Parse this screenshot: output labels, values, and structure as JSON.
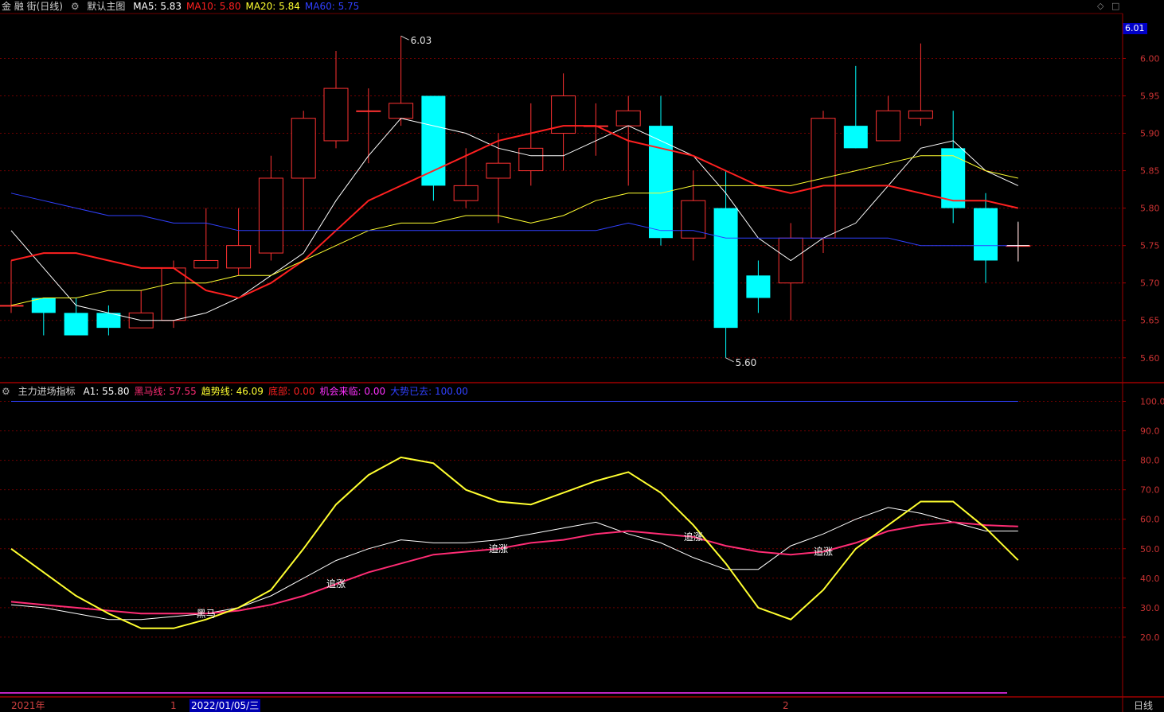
{
  "header": {
    "stock_name": "金 融 街(日线)",
    "main_chart_label": "默认主图",
    "ma": [
      {
        "label": "MA5: 5.83",
        "color": "#ffffff"
      },
      {
        "label": "MA10: 5.80",
        "color": "#ff2020"
      },
      {
        "label": "MA20: 5.84",
        "color": "#ffff30"
      },
      {
        "label": "MA60: 5.75",
        "color": "#3040ff"
      }
    ]
  },
  "indicator": {
    "name": "主力进场指标",
    "values": [
      {
        "label": "A1: 55.80",
        "color": "#ffffff"
      },
      {
        "label": "黑马线: 57.55",
        "color": "#ff2c74"
      },
      {
        "label": "趋势线: 46.09",
        "color": "#ffff30"
      },
      {
        "label": "底部: 0.00",
        "color": "#ff2020"
      },
      {
        "label": "机会来临: 0.00",
        "color": "#ff30ff"
      },
      {
        "label": "大势已去: 100.00",
        "color": "#3040ff"
      }
    ]
  },
  "axis_bottom": {
    "year_label": "2021年",
    "month_1": "1",
    "month_2": "2",
    "cursor_date": "2022/01/05/三",
    "period_label": "日线"
  },
  "price_tag": "6.01",
  "colors": {
    "up": "#ff3232",
    "down": "#00ffff",
    "grid": "#6e0000",
    "bg": "#000000"
  },
  "chart_data": [
    {
      "type": "candlestick",
      "title": "金 融 街(日线)",
      "ylim": [
        5.57,
        6.06
      ],
      "y_ticks": [
        5.6,
        5.65,
        5.7,
        5.75,
        5.8,
        5.85,
        5.9,
        5.95,
        6.0
      ],
      "annotations": [
        {
          "text": "6.03",
          "value": 6.03,
          "at_index": 12
        },
        {
          "text": "5.60",
          "value": 5.6,
          "at_index": 22
        }
      ],
      "candles": [
        {
          "o": 5.67,
          "h": 5.73,
          "l": 5.66,
          "c": 5.67
        },
        {
          "o": 5.68,
          "h": 5.68,
          "l": 5.63,
          "c": 5.66
        },
        {
          "o": 5.66,
          "h": 5.68,
          "l": 5.63,
          "c": 5.63
        },
        {
          "o": 5.66,
          "h": 5.67,
          "l": 5.63,
          "c": 5.64
        },
        {
          "o": 5.64,
          "h": 5.69,
          "l": 5.64,
          "c": 5.66
        },
        {
          "o": 5.65,
          "h": 5.73,
          "l": 5.64,
          "c": 5.72
        },
        {
          "o": 5.72,
          "h": 5.8,
          "l": 5.72,
          "c": 5.73
        },
        {
          "o": 5.72,
          "h": 5.8,
          "l": 5.71,
          "c": 5.75
        },
        {
          "o": 5.74,
          "h": 5.87,
          "l": 5.73,
          "c": 5.84
        },
        {
          "o": 5.84,
          "h": 5.93,
          "l": 5.77,
          "c": 5.92
        },
        {
          "o": 5.89,
          "h": 6.01,
          "l": 5.88,
          "c": 5.96
        },
        {
          "o": 5.93,
          "h": 5.96,
          "l": 5.86,
          "c": 5.93
        },
        {
          "o": 5.92,
          "h": 6.03,
          "l": 5.91,
          "c": 5.94
        },
        {
          "o": 5.95,
          "h": 5.95,
          "l": 5.81,
          "c": 5.83
        },
        {
          "o": 5.81,
          "h": 5.88,
          "l": 5.8,
          "c": 5.83
        },
        {
          "o": 5.84,
          "h": 5.9,
          "l": 5.78,
          "c": 5.86
        },
        {
          "o": 5.85,
          "h": 5.94,
          "l": 5.83,
          "c": 5.88
        },
        {
          "o": 5.9,
          "h": 5.98,
          "l": 5.85,
          "c": 5.95
        },
        {
          "o": 5.91,
          "h": 5.94,
          "l": 5.87,
          "c": 5.91
        },
        {
          "o": 5.91,
          "h": 5.95,
          "l": 5.83,
          "c": 5.93
        },
        {
          "o": 5.91,
          "h": 5.95,
          "l": 5.75,
          "c": 5.76
        },
        {
          "o": 5.76,
          "h": 5.85,
          "l": 5.73,
          "c": 5.81
        },
        {
          "o": 5.8,
          "h": 5.85,
          "l": 5.6,
          "c": 5.64
        },
        {
          "o": 5.71,
          "h": 5.73,
          "l": 5.66,
          "c": 5.68
        },
        {
          "o": 5.7,
          "h": 5.78,
          "l": 5.65,
          "c": 5.76
        },
        {
          "o": 5.76,
          "h": 5.93,
          "l": 5.74,
          "c": 5.92
        },
        {
          "o": 5.91,
          "h": 5.99,
          "l": 5.88,
          "c": 5.88
        },
        {
          "o": 5.89,
          "h": 5.95,
          "l": 5.89,
          "c": 5.93
        },
        {
          "o": 5.92,
          "h": 6.02,
          "l": 5.91,
          "c": 5.93
        },
        {
          "o": 5.88,
          "h": 5.93,
          "l": 5.78,
          "c": 5.8
        },
        {
          "o": 5.8,
          "h": 5.82,
          "l": 5.7,
          "c": 5.73
        },
        {
          "o": 5.75,
          "h": 5.78,
          "l": 5.73,
          "c": 5.75
        }
      ],
      "series": [
        {
          "name": "MA5",
          "color": "#ffffff",
          "values": [
            5.77,
            5.72,
            5.67,
            5.66,
            5.65,
            5.65,
            5.66,
            5.68,
            5.71,
            5.74,
            5.81,
            5.87,
            5.92,
            5.91,
            5.9,
            5.88,
            5.87,
            5.87,
            5.89,
            5.91,
            5.89,
            5.87,
            5.82,
            5.76,
            5.73,
            5.76,
            5.78,
            5.83,
            5.88,
            5.89,
            5.85,
            5.83
          ]
        },
        {
          "name": "MA10",
          "color": "#ff2020",
          "values": [
            5.73,
            5.74,
            5.74,
            5.73,
            5.72,
            5.72,
            5.69,
            5.68,
            5.7,
            5.73,
            5.77,
            5.81,
            5.83,
            5.85,
            5.87,
            5.89,
            5.9,
            5.91,
            5.91,
            5.89,
            5.88,
            5.87,
            5.85,
            5.83,
            5.82,
            5.83,
            5.83,
            5.83,
            5.82,
            5.81,
            5.81,
            5.8
          ]
        },
        {
          "name": "MA20",
          "color": "#ffff30",
          "values": [
            5.67,
            5.68,
            5.68,
            5.69,
            5.69,
            5.7,
            5.7,
            5.71,
            5.71,
            5.73,
            5.75,
            5.77,
            5.78,
            5.78,
            5.79,
            5.79,
            5.78,
            5.79,
            5.81,
            5.82,
            5.82,
            5.83,
            5.83,
            5.83,
            5.83,
            5.84,
            5.85,
            5.86,
            5.87,
            5.87,
            5.85,
            5.84
          ]
        },
        {
          "name": "MA60",
          "color": "#3040ff",
          "values": [
            5.82,
            5.81,
            5.8,
            5.79,
            5.79,
            5.78,
            5.78,
            5.77,
            5.77,
            5.77,
            5.77,
            5.77,
            5.77,
            5.77,
            5.77,
            5.77,
            5.77,
            5.77,
            5.77,
            5.78,
            5.77,
            5.77,
            5.76,
            5.76,
            5.76,
            5.76,
            5.76,
            5.76,
            5.75,
            5.75,
            5.75,
            5.75
          ]
        }
      ]
    },
    {
      "type": "line",
      "title": "主力进场指标",
      "ylim": [
        0,
        105
      ],
      "y_ticks": [
        20,
        30,
        40,
        50,
        60,
        70,
        80,
        90,
        100
      ],
      "series": [
        {
          "name": "A1",
          "color": "#ffffff",
          "values": [
            31,
            30,
            28,
            26,
            26,
            27,
            28,
            30,
            34,
            40,
            46,
            50,
            53,
            52,
            52,
            53,
            55,
            57,
            59,
            55,
            52,
            47,
            43,
            43,
            51,
            55,
            60,
            64,
            62,
            59,
            56,
            56
          ]
        },
        {
          "name": "黑马线",
          "color": "#ff2c74",
          "values": [
            32,
            31,
            30,
            29,
            28,
            28,
            28,
            29,
            31,
            34,
            38,
            42,
            45,
            48,
            49,
            50,
            52,
            53,
            55,
            56,
            55,
            54,
            51,
            49,
            48,
            49,
            52,
            56,
            58,
            59,
            58,
            57.55
          ]
        },
        {
          "name": "趋势线",
          "color": "#ffff30",
          "values": [
            50,
            42,
            34,
            28,
            23,
            23,
            26,
            30,
            36,
            50,
            65,
            75,
            81,
            79,
            70,
            66,
            65,
            69,
            73,
            76,
            69,
            58,
            45,
            30,
            26,
            36,
            50,
            58,
            66,
            66,
            57,
            46.09
          ]
        },
        {
          "name": "大势已去",
          "color": "#3040ff",
          "values": [
            100,
            100,
            100,
            100,
            100,
            100,
            100,
            100,
            100,
            100,
            100,
            100,
            100,
            100,
            100,
            100,
            100,
            100,
            100,
            100,
            100,
            100,
            100,
            100,
            100,
            100,
            100,
            100,
            100,
            100,
            100,
            100
          ]
        }
      ],
      "annotations": [
        {
          "text": "黑马",
          "at_index": 6,
          "value": 28
        },
        {
          "text": "追涨",
          "at_index": 10,
          "value": 38
        },
        {
          "text": "追涨",
          "at_index": 15,
          "value": 50
        },
        {
          "text": "追涨",
          "at_index": 21,
          "value": 54
        },
        {
          "text": "追涨",
          "at_index": 25,
          "value": 49
        }
      ]
    }
  ]
}
